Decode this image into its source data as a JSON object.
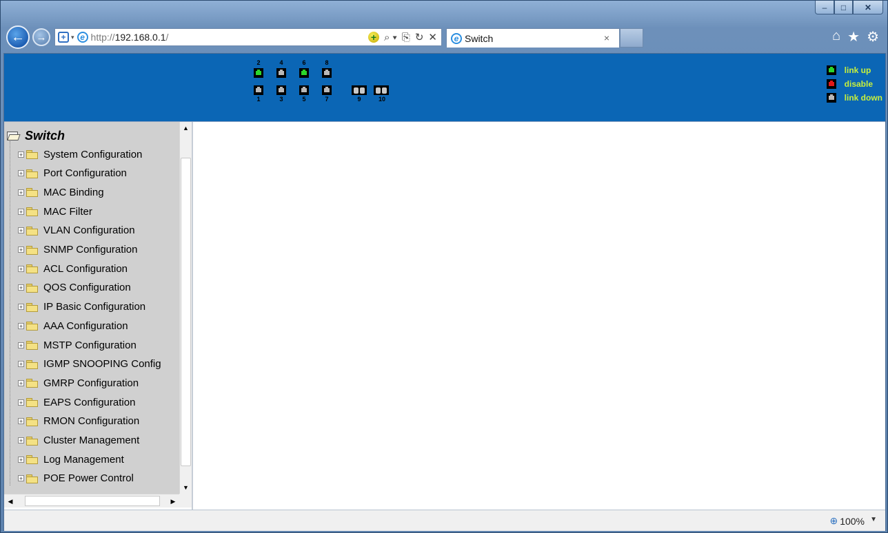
{
  "browser": {
    "window_controls": {
      "minimize": "–",
      "maximize": "□",
      "close": "✕"
    },
    "back_glyph": "←",
    "forward_glyph": "→",
    "url_prefix": "http://",
    "url_host": "192.168.0.1",
    "url_suffix": "/",
    "address_tools": [
      "⌕ ▾",
      "⎘",
      "↻",
      "✕"
    ],
    "tab_title": "Switch",
    "tab_close": "×",
    "right_tools": [
      "⌂",
      "★",
      "⚙"
    ],
    "status_zoom": "100%",
    "zoom_icon": "⊕"
  },
  "switch_panel": {
    "top_port_labels": [
      "2",
      "4",
      "6",
      "8"
    ],
    "bottom_port_labels": [
      "1",
      "3",
      "5",
      "7",
      "9",
      "10"
    ],
    "port_states": {
      "1": "link-down",
      "2": "link-up",
      "3": "link-down",
      "4": "link-down",
      "5": "link-down",
      "6": "link-up",
      "7": "link-down",
      "8": "link-down"
    },
    "legend": [
      {
        "label": "link up",
        "color": "#2bd62b"
      },
      {
        "label": "disable",
        "color": "#e01818"
      },
      {
        "label": "link down",
        "color": "#b8b8b8"
      }
    ]
  },
  "tree": {
    "root": "Switch",
    "items": [
      "System Configuration",
      "Port Configuration",
      "MAC Binding",
      "MAC Filter",
      "VLAN Configuration",
      "SNMP Configuration",
      "ACL Configuration",
      "QOS Configuration",
      "IP Basic Configuration",
      "AAA Configuration",
      "MSTP Configuration",
      "IGMP SNOOPING Config",
      "GMRP Configuration",
      "EAPS Configuration",
      "RMON Configuration",
      "Cluster Management",
      "Log Management",
      "POE Power Control"
    ]
  },
  "colors": {
    "banner": "#0b66b5",
    "legend_text": "#c8f03c",
    "tree_bg": "#d0d0d0"
  }
}
